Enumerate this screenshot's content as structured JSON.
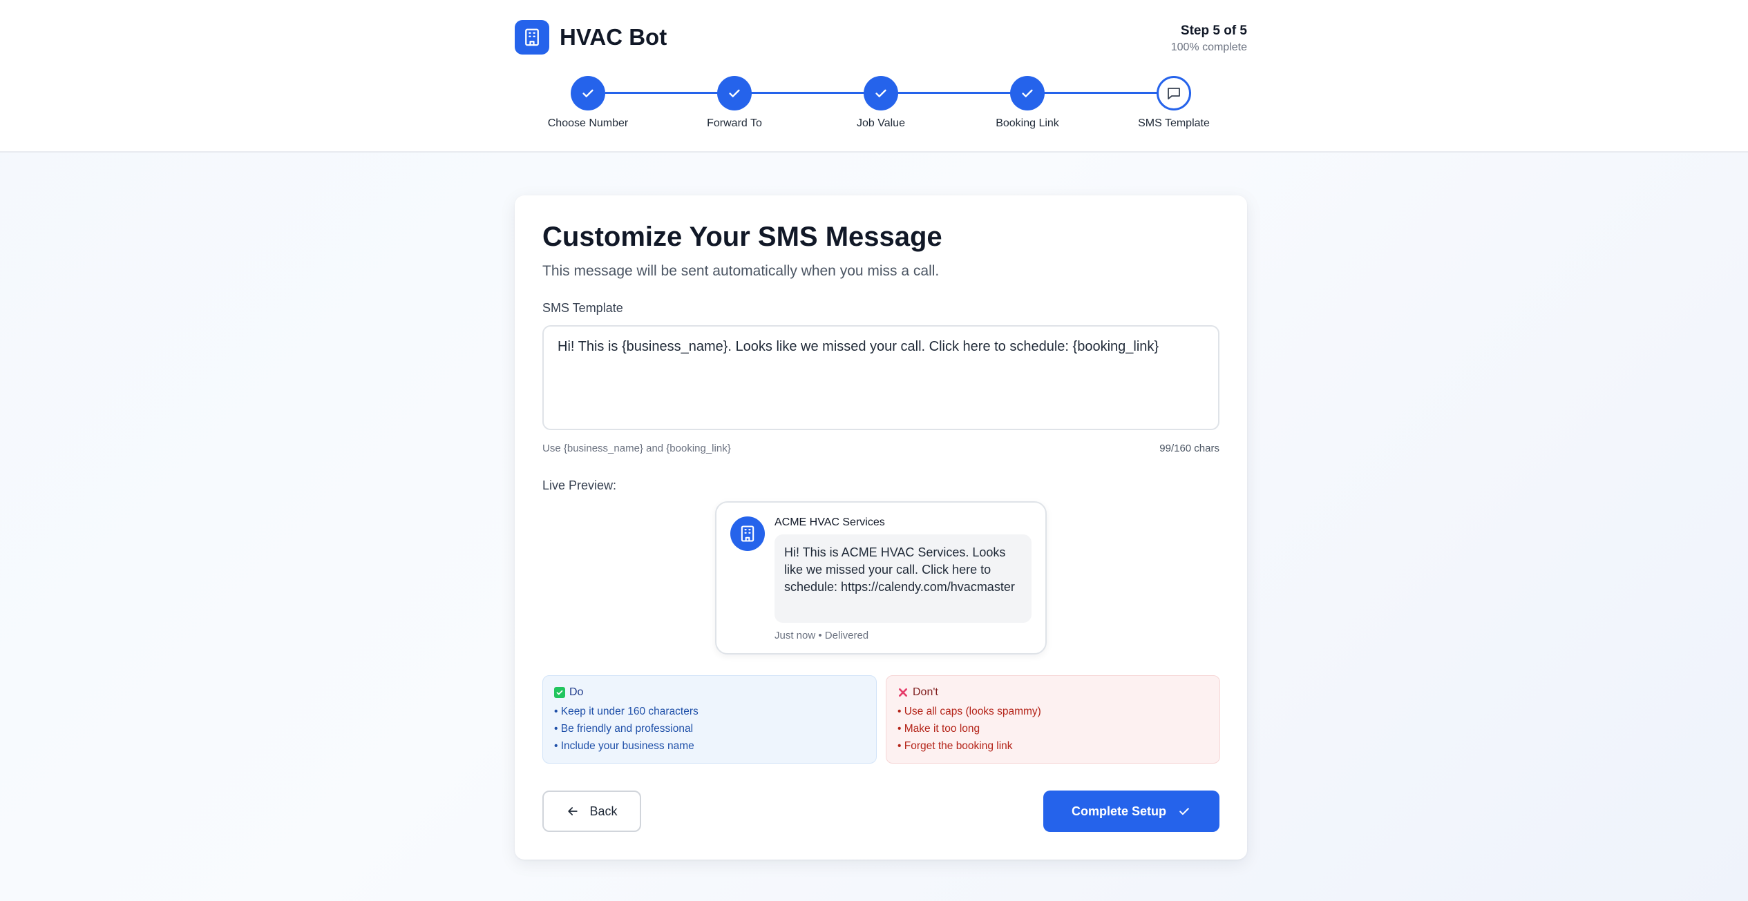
{
  "header": {
    "brand_name": "HVAC Bot",
    "step_label": "Step 5 of 5",
    "progress_text": "100% complete",
    "brand_color": "#2563eb"
  },
  "stepper": {
    "steps": [
      {
        "label": "Choose Number",
        "status": "complete",
        "icon": "check-icon"
      },
      {
        "label": "Forward To",
        "status": "complete",
        "icon": "check-icon"
      },
      {
        "label": "Job Value",
        "status": "complete",
        "icon": "check-icon"
      },
      {
        "label": "Booking Link",
        "status": "complete",
        "icon": "check-icon"
      },
      {
        "label": "SMS Template",
        "status": "current",
        "icon": "message-square-icon"
      }
    ]
  },
  "card": {
    "title": "Customize Your SMS Message",
    "subtitle": "This message will be sent automatically when you miss a call.",
    "field_label": "SMS Template",
    "template_value": "Hi! This is {business_name}. Looks like we missed your call. Click here to schedule: {booking_link}",
    "hint": "Use {business_name} and {booking_link}",
    "char_count": "99/160 chars",
    "preview_label": "Live Preview:"
  },
  "preview": {
    "sender": "ACME HVAC Services",
    "message": "Hi! This is ACME HVAC Services. Looks like we missed your call. Click here to schedule: https://calendy.com/hvacmaster",
    "meta": "Just now • Delivered",
    "avatar_icon": "building-icon"
  },
  "tips": {
    "do": {
      "title": "Do",
      "icon": "green-check-box-icon",
      "items": [
        "• Keep it under 160 characters",
        "• Be friendly and professional",
        "• Include your business name"
      ]
    },
    "dont": {
      "title": "Don't",
      "icon": "red-x-icon",
      "items": [
        "• Use all caps (looks spammy)",
        "• Make it too long",
        "• Forget the booking link"
      ]
    }
  },
  "actions": {
    "back_label": "Back",
    "complete_label": "Complete Setup"
  }
}
